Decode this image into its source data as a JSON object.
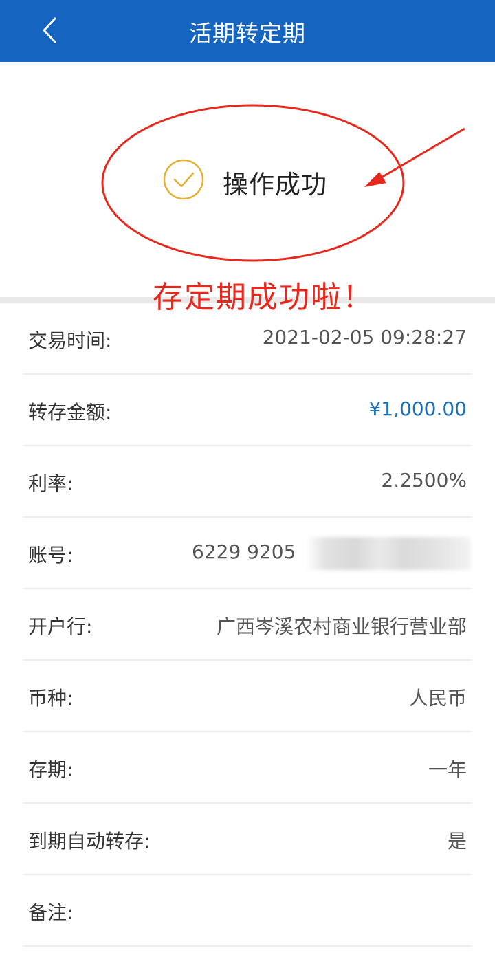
{
  "header": {
    "title": "活期转定期",
    "back_icon": "chevron-left-icon",
    "background_color": "#1565c0"
  },
  "result": {
    "icon": "check-circle-icon",
    "icon_color": "#e6b030",
    "message": "操作成功"
  },
  "annotation": {
    "text": "存定期成功啦！",
    "color": "#e8281c"
  },
  "details": [
    {
      "label": "交易时间:",
      "value": "2021-02-05 09:28:27"
    },
    {
      "label": "转存金额:",
      "value": "¥1,000.00"
    },
    {
      "label": "利率:",
      "value": "2.2500%"
    },
    {
      "label": "账号:",
      "value": "6229 9205"
    },
    {
      "label": "开户行:",
      "value": "广西岑溪农村商业银行营业部"
    },
    {
      "label": "币种:",
      "value": "人民币"
    },
    {
      "label": "存期:",
      "value": "一年"
    },
    {
      "label": "到期自动转存:",
      "value": "是"
    },
    {
      "label": "备注:",
      "value": ""
    }
  ]
}
